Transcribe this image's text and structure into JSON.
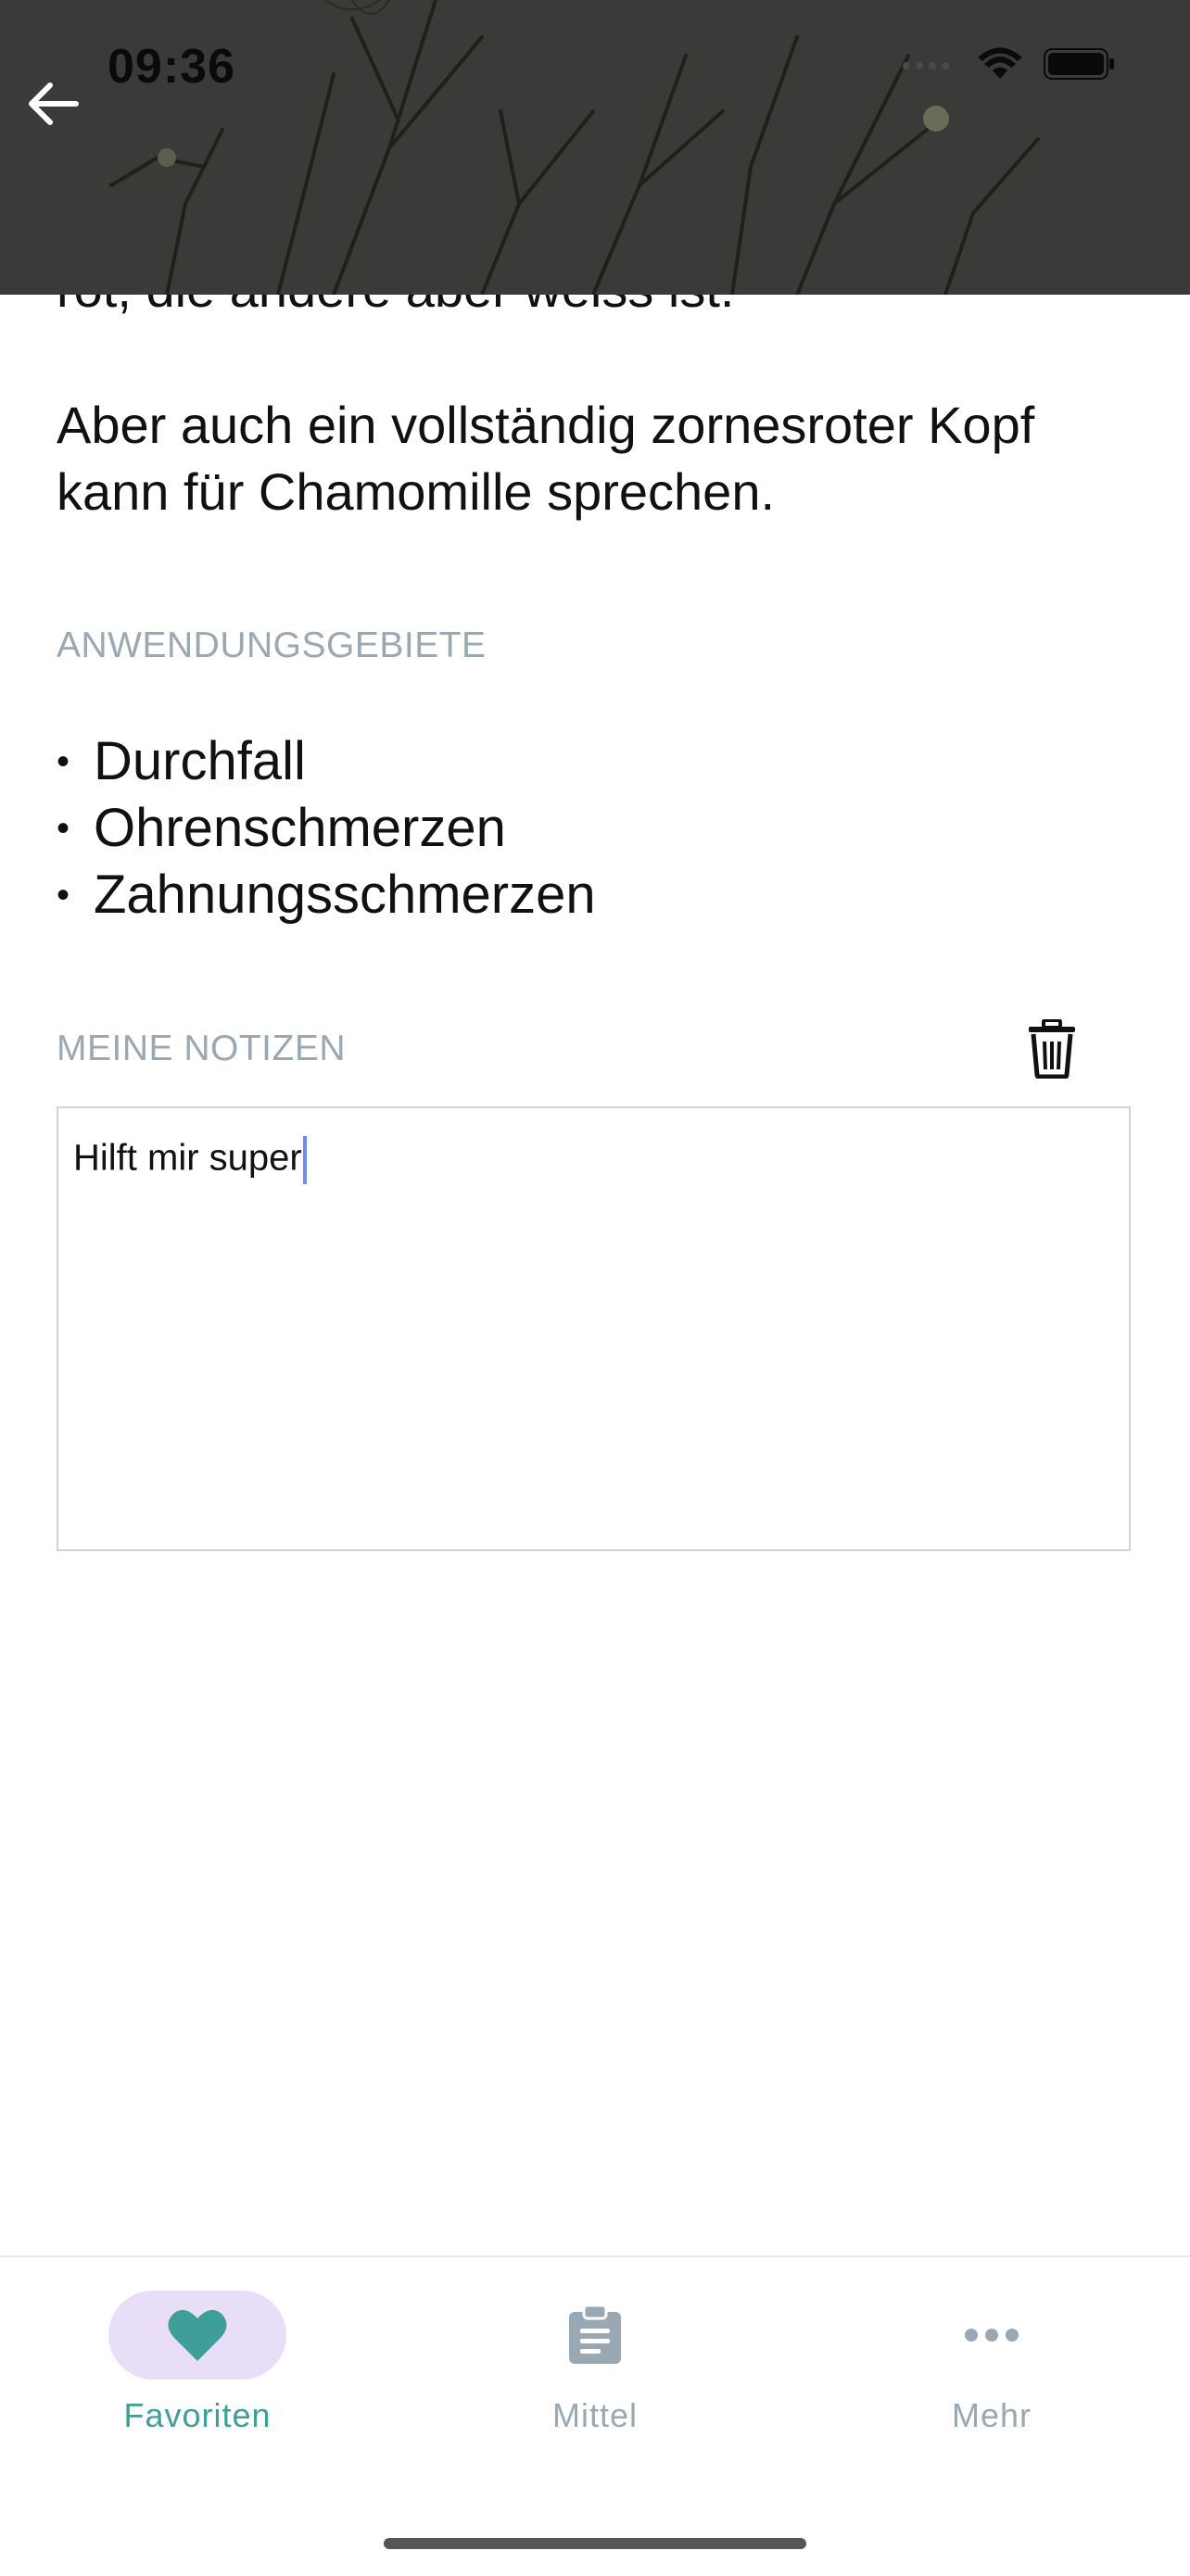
{
  "status_bar": {
    "time": "09:36"
  },
  "header": {
    "back_icon": "arrow-left-icon"
  },
  "content": {
    "paragraph_cut": "rot, die andere aber weiss ist.",
    "paragraph_main": "Aber auch ein vollständig zornesroter Kopf kann für Chamomille sprechen.",
    "uses_label": "ANWENDUNGSGEBIETE",
    "uses": [
      "Durchfall",
      "Ohrenschmerzen",
      "Zahnungsschmerzen"
    ],
    "bullet": "•",
    "notes_label": "MEINE NOTIZEN",
    "notes_value": "Hilft mir super",
    "delete_icon": "trash-icon"
  },
  "tabbar": {
    "tabs": [
      {
        "label": "Favoriten",
        "icon": "heart-icon",
        "active": true
      },
      {
        "label": "Mittel",
        "icon": "clipboard-icon",
        "active": false
      },
      {
        "label": "Mehr",
        "icon": "more-dots-icon",
        "active": false
      }
    ]
  },
  "colors": {
    "accent": "#3d9e9a",
    "active_tab_bg": "#e9def8",
    "section_label": "#9aa8b4",
    "caret": "#6b8cff",
    "header_bg": "#3a3a38"
  }
}
